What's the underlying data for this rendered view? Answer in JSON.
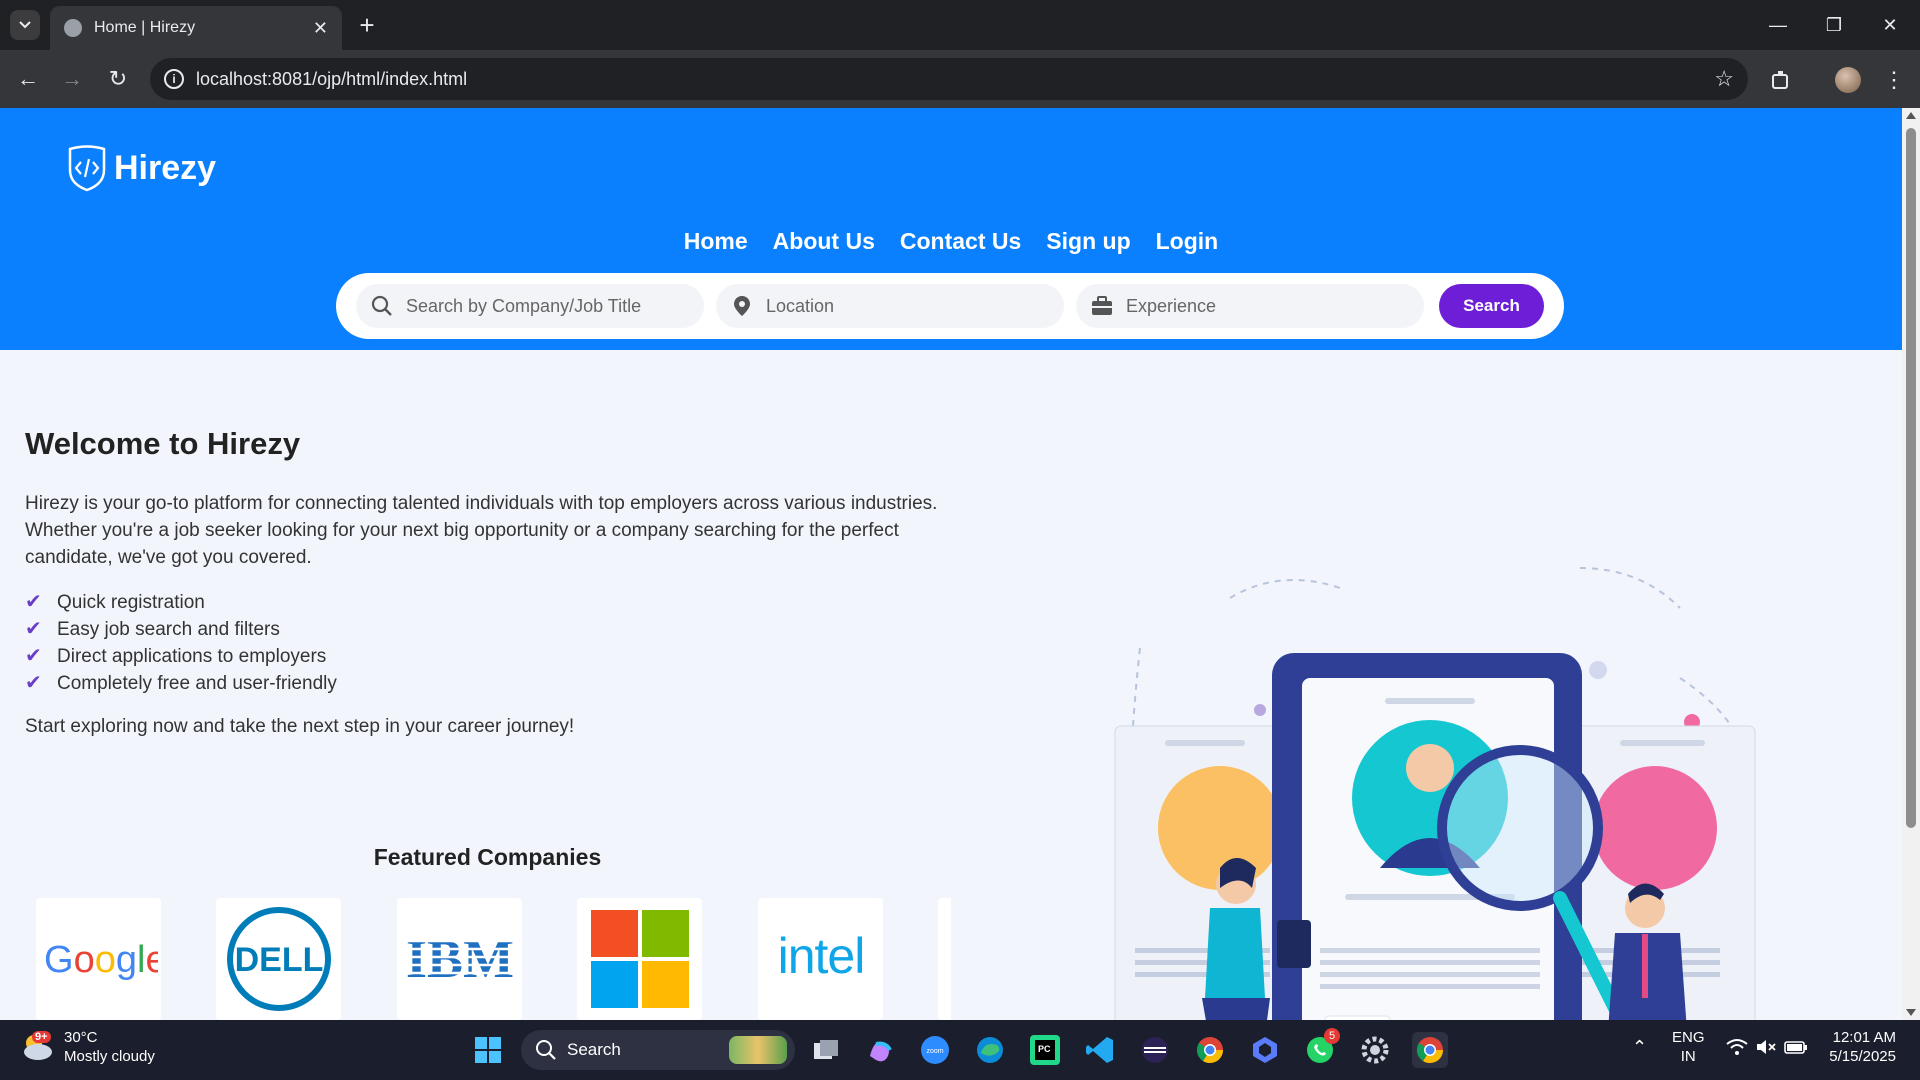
{
  "browser": {
    "tab_title": "Home | Hirezy",
    "url": "localhost:8081/ojp/html/index.html"
  },
  "site": {
    "brand": "Hirezy",
    "nav": [
      "Home",
      "About Us",
      "Contact Us",
      "Sign up",
      "Login"
    ],
    "search": {
      "company_placeholder": "Search by Company/Job Title",
      "location_placeholder": "Location",
      "experience_placeholder": "Experience",
      "button": "Search"
    },
    "welcome": {
      "title": "Welcome to Hirezy",
      "intro": "Hirezy is your go-to platform for connecting talented individuals with top employers across various industries. Whether you're a job seeker looking for your next big opportunity or a company searching for the perfect candidate, we've got you covered.",
      "features": [
        "Quick registration",
        "Easy job search and filters",
        "Direct applications to employers",
        "Completely free and user-friendly"
      ],
      "outro": "Start exploring now and take the next step in your career journey!"
    },
    "featured": {
      "title": "Featured Companies",
      "companies": [
        "Google",
        "Dell",
        "IBM",
        "Microsoft",
        "intel"
      ]
    }
  },
  "taskbar": {
    "temperature": "30°C",
    "weather": "Mostly cloudy",
    "weather_badge": "9+",
    "search_label": "Search",
    "whatsapp_badge": "5",
    "language": "ENG",
    "region": "IN",
    "time": "12:01 AM",
    "date": "5/15/2025"
  },
  "colors": {
    "hero_blue": "#0a80ff",
    "search_button": "#6e1ed6",
    "check": "#6c3dc6"
  }
}
